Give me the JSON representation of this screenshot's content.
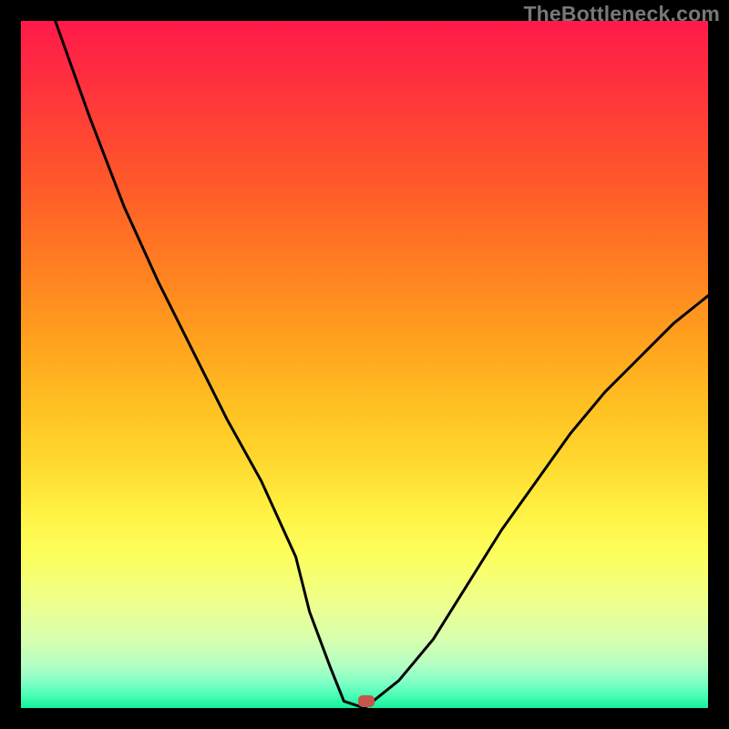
{
  "watermark": "TheBottleneck.com",
  "chart_data": {
    "type": "line",
    "title": "",
    "xlabel": "",
    "ylabel": "",
    "xlim": [
      0,
      100
    ],
    "ylim": [
      0,
      100
    ],
    "grid": false,
    "legend": false,
    "background": "rainbow-gradient (red→orange→yellow→green, top→bottom)",
    "series": [
      {
        "name": "bottleneck-curve",
        "color": "#000000",
        "x": [
          5,
          10,
          15,
          20,
          25,
          30,
          35,
          40,
          42,
          45,
          47,
          50,
          55,
          60,
          65,
          70,
          75,
          80,
          85,
          90,
          95,
          100
        ],
        "y": [
          100,
          86,
          73,
          62,
          52,
          42,
          33,
          22,
          14,
          6,
          1,
          0,
          4,
          10,
          18,
          26,
          33,
          40,
          46,
          51,
          56,
          60
        ]
      }
    ],
    "marker": {
      "x": 50,
      "y": 0,
      "color": "#c4564a",
      "shape": "rounded-rect"
    },
    "notes": "V-shaped bottleneck curve; minimum near x≈50 at y≈0. No axis ticks or labels are rendered – values estimated from shape."
  }
}
